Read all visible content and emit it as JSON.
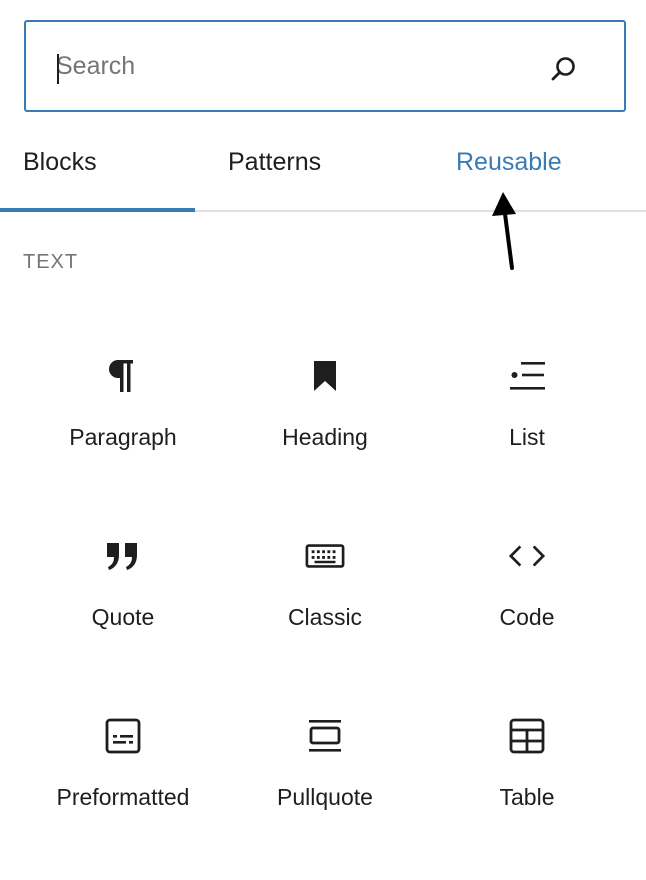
{
  "search": {
    "placeholder": "Search"
  },
  "tabs": [
    {
      "label": "Blocks",
      "selected": true
    },
    {
      "label": "Patterns",
      "selected": false
    },
    {
      "label": "Reusable",
      "selected": false
    }
  ],
  "section": {
    "title": "TEXT"
  },
  "blocks": [
    {
      "label": "Paragraph",
      "icon": "paragraph-icon"
    },
    {
      "label": "Heading",
      "icon": "bookmark-icon"
    },
    {
      "label": "List",
      "icon": "list-icon"
    },
    {
      "label": "Quote",
      "icon": "quote-icon"
    },
    {
      "label": "Classic",
      "icon": "keyboard-icon"
    },
    {
      "label": "Code",
      "icon": "code-icon"
    },
    {
      "label": "Preformatted",
      "icon": "preformatted-icon"
    },
    {
      "label": "Pullquote",
      "icon": "pullquote-icon"
    },
    {
      "label": "Table",
      "icon": "table-icon"
    }
  ],
  "colors": {
    "accent": "#3a7bb5",
    "text": "#1e1e1e",
    "muted": "#757575",
    "divider": "#e0e0e0"
  }
}
